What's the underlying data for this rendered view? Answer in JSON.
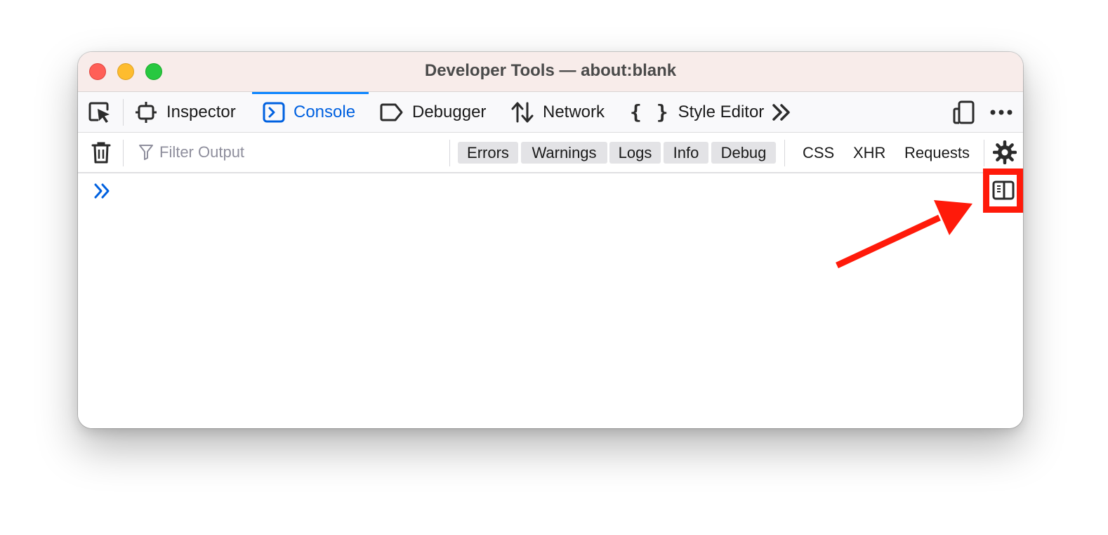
{
  "window": {
    "title": "Developer Tools — about:blank"
  },
  "toolbar": {
    "picker_icon": "element-picker-icon",
    "tabs": [
      {
        "label": "Inspector",
        "icon": "inspector-icon",
        "active": false
      },
      {
        "label": "Console",
        "icon": "console-icon",
        "active": true
      },
      {
        "label": "Debugger",
        "icon": "debugger-icon",
        "active": false
      },
      {
        "label": "Network",
        "icon": "network-icon",
        "active": false
      },
      {
        "label": "Style Editor",
        "icon": "style-editor-icon",
        "active": false
      }
    ],
    "overflow_icon": "chevron-double-right-icon",
    "right_icons": [
      "responsive-design-icon",
      "more-options-icon"
    ]
  },
  "filterbar": {
    "clear_icon": "trash-icon",
    "filter_icon": "funnel-icon",
    "filter_placeholder": "Filter Output",
    "levels": [
      "Errors",
      "Warnings",
      "Logs",
      "Info",
      "Debug"
    ],
    "types": [
      "CSS",
      "XHR",
      "Requests"
    ],
    "settings_icon": "gear-icon"
  },
  "console": {
    "prompt_icon": "prompt-chevron-icon",
    "sidebar_toggle_icon": "sidebar-toggle-icon"
  },
  "annotation": {
    "color": "#ff1a0a",
    "accent": "#0061e0"
  }
}
